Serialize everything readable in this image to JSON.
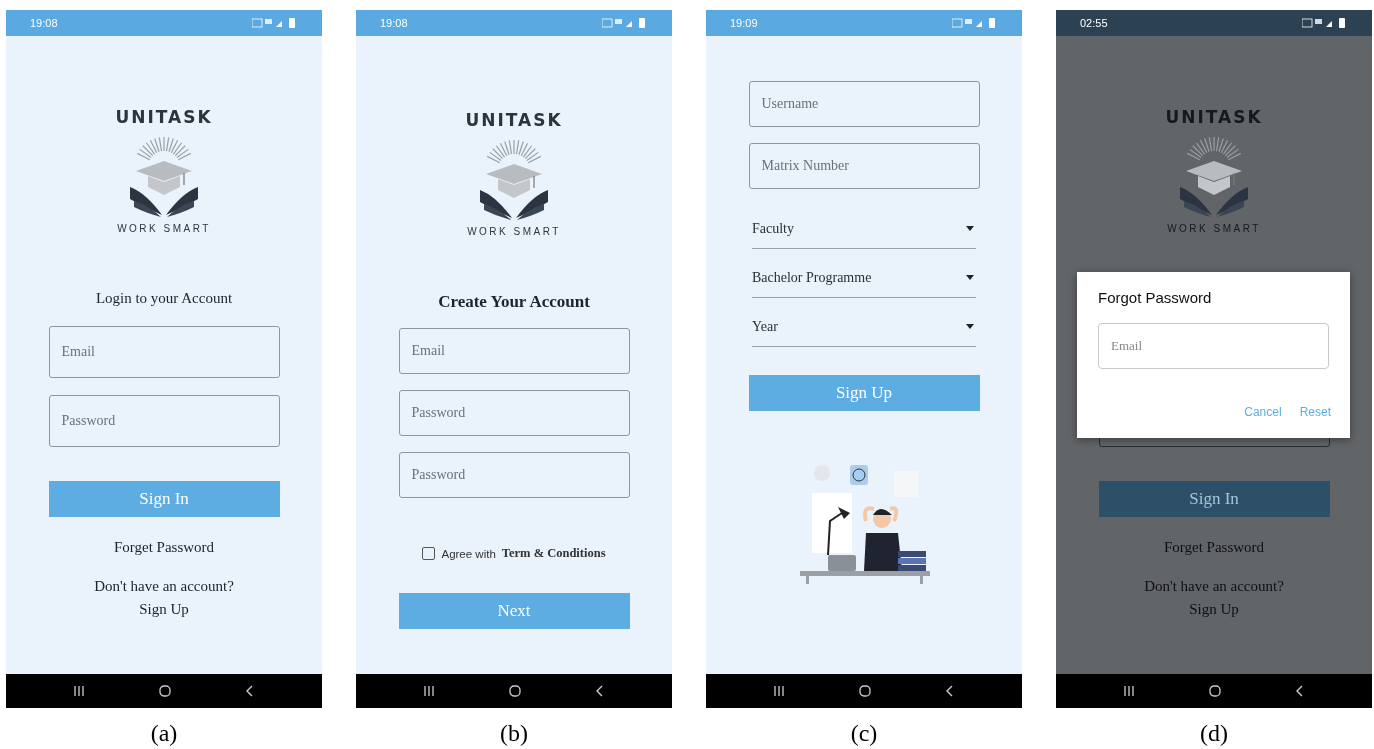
{
  "screens": [
    {
      "kind": "login",
      "caption": "(a)",
      "time": "19:08",
      "dimmed": false,
      "logo": {
        "title": "UNITASK",
        "tagline": "WORK SMART"
      },
      "heading": "Login to your Account",
      "fields": [
        {
          "kind": "input",
          "placeholder": "Email"
        },
        {
          "kind": "input",
          "placeholder": "Password"
        }
      ],
      "button": "Sign In",
      "link": "Forget Password",
      "prompt": "Don't have an account?",
      "prompt_link": "Sign Up"
    },
    {
      "kind": "register",
      "caption": "(b)",
      "time": "19:08",
      "dimmed": false,
      "logo": {
        "title": "UNITASK",
        "tagline": "WORK SMART"
      },
      "heading": "Create Your Account",
      "fields": [
        {
          "kind": "input",
          "placeholder": "Email"
        },
        {
          "kind": "input",
          "placeholder": "Password"
        },
        {
          "kind": "input",
          "placeholder": "Password"
        }
      ],
      "checkbox": {
        "label": "Agree with",
        "link": "Term & Conditions",
        "checked": false
      },
      "button": "Next"
    },
    {
      "kind": "details",
      "caption": "(c)",
      "time": "19:09",
      "dimmed": false,
      "fields": [
        {
          "kind": "input",
          "placeholder": "Username"
        },
        {
          "kind": "input",
          "placeholder": "Matrix Number"
        },
        {
          "kind": "select",
          "label": "Faculty"
        },
        {
          "kind": "select",
          "label": "Bachelor Programme"
        },
        {
          "kind": "select",
          "label": "Year"
        }
      ],
      "button": "Sign Up"
    },
    {
      "kind": "login",
      "caption": "(d)",
      "time": "02:55",
      "dimmed": true,
      "logo": {
        "title": "UNITASK",
        "tagline": "WORK SMART"
      },
      "fields": [
        {
          "kind": "hidden"
        },
        {
          "kind": "input"
        }
      ],
      "button": "Sign In",
      "link": "Forget Password",
      "prompt": "Don't have an account?",
      "prompt_link": "Sign Up",
      "dialog": {
        "title": "Forgot Password",
        "placeholder": "Email",
        "actions": [
          "Cancel",
          "Reset"
        ]
      }
    }
  ]
}
